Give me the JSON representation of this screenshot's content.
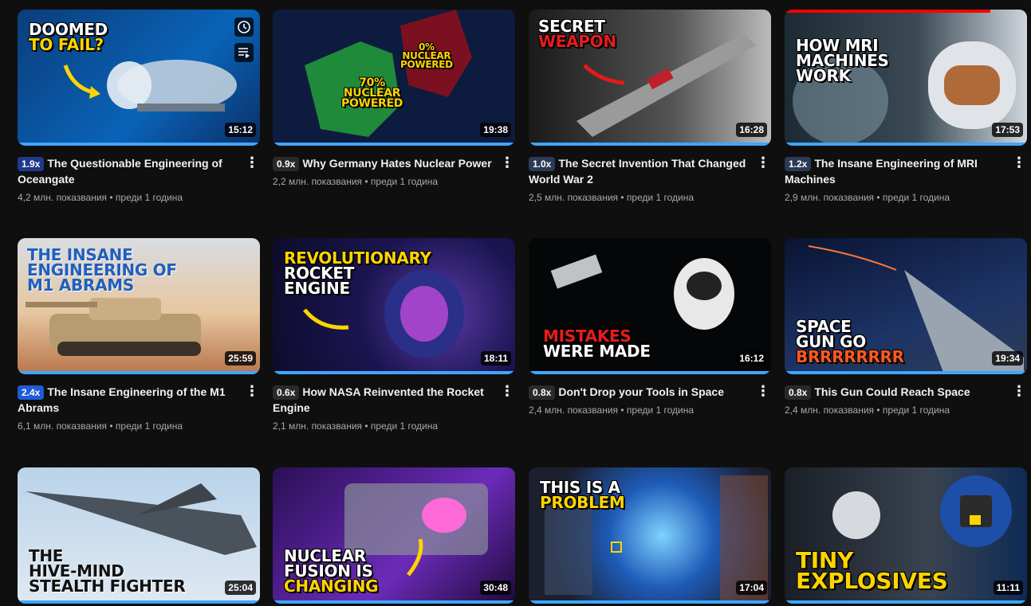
{
  "videos": [
    {
      "title": "The Questionable Engineering of Oceangate",
      "speed": "1.9x",
      "speed_color": "#1f3a8a",
      "views": "4,2 млн. показвания",
      "age": "преди 1 година",
      "duration": "15:12",
      "overlay": "DOOMED\nTO FAIL?",
      "progress": 1.0
    },
    {
      "title": "Why Germany Hates Nuclear Power",
      "speed": "0.9x",
      "speed_color": "#2a2a2a",
      "views": "2,2 млн. показвания",
      "age": "преди 1 година",
      "duration": "19:38",
      "overlay": "70%\nNUCLEAR\nPOWERED",
      "overlay2": "0%\nNUCLEAR\nPOWERED",
      "progress": 1.0
    },
    {
      "title": "The Secret Invention That Changed World War 2",
      "speed": "1.0x",
      "speed_color": "#2b3a55",
      "views": "2,5 млн. показвания",
      "age": "преди 1 година",
      "duration": "16:28",
      "overlay": "SECRET\nWEAPON",
      "progress": 1.0
    },
    {
      "title": "The Insane Engineering of MRI Machines",
      "speed": "1.2x",
      "speed_color": "#2b3a55",
      "views": "2,9 млн. показвания",
      "age": "преди 1 година",
      "duration": "17:53",
      "overlay": "HOW MRI\nMACHINES\nWORK",
      "progress": 1.0,
      "top_progress": 0.85
    },
    {
      "title": "The Insane Engineering of the M1 Abrams",
      "speed": "2.4x",
      "speed_color": "#1e5bd6",
      "views": "6,1 млн. показвания",
      "age": "преди 1 година",
      "duration": "25:59",
      "overlay": "THE INSANE\nENGINEERING OF\nM1 ABRAMS",
      "progress": 1.0
    },
    {
      "title": "How NASA Reinvented the Rocket Engine",
      "speed": "0.6x",
      "speed_color": "#2a2a2a",
      "views": "2,1 млн. показвания",
      "age": "преди 1 година",
      "duration": "18:11",
      "overlay": "REVOLUTIONARY\nROCKET\nENGINE",
      "progress": 1.0
    },
    {
      "title": "Don't Drop your Tools in Space",
      "speed": "0.8x",
      "speed_color": "#2a2a2a",
      "views": "2,4 млн. показвания",
      "age": "преди 1 година",
      "duration": "16:12",
      "overlay": "MISTAKES\nWERE MADE",
      "progress": 1.0
    },
    {
      "title": "This Gun Could Reach Space",
      "speed": "0.8x",
      "speed_color": "#2a2a2a",
      "views": "2,4 млн. показвания",
      "age": "преди 1 година",
      "duration": "19:34",
      "overlay": "SPACE\nGUN GO\nBRRRRRRRR",
      "progress": 1.0
    },
    {
      "title": "",
      "speed": "",
      "speed_color": "#2a2a2a",
      "views": "",
      "age": "",
      "duration": "25:04",
      "overlay": "THE\nHIVE-MIND\nSTEALTH FIGHTER",
      "progress": 1.0
    },
    {
      "title": "",
      "speed": "",
      "speed_color": "#2a2a2a",
      "views": "",
      "age": "",
      "duration": "30:48",
      "overlay": "NUCLEAR\nFUSION IS\nCHANGING",
      "progress": 1.0
    },
    {
      "title": "",
      "speed": "",
      "speed_color": "#2a2a2a",
      "views": "",
      "age": "",
      "duration": "17:04",
      "overlay": "THIS IS A\nPROBLEM",
      "progress": 1.0
    },
    {
      "title": "",
      "speed": "",
      "speed_color": "#2a2a2a",
      "views": "",
      "age": "",
      "duration": "11:11",
      "overlay": "TINY\nEXPLOSIVES",
      "progress": 1.0
    }
  ],
  "colors": {
    "accent": "#3ea6ff",
    "yellow": "#ffd400",
    "red": "#ff0000"
  },
  "hover_icons": [
    "clock-icon",
    "queue-icon"
  ]
}
